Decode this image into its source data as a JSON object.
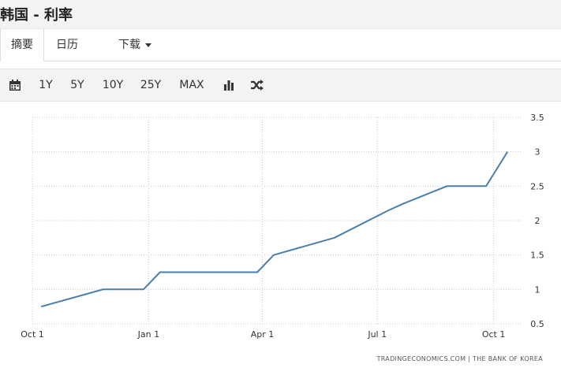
{
  "header": {
    "title": "韩国 - 利率"
  },
  "tabs": [
    {
      "label": "摘要",
      "active": true
    },
    {
      "label": "日历",
      "active": false
    },
    {
      "label": "下载",
      "active": false
    }
  ],
  "toolbar": {
    "calendar_icon": "calendar-icon",
    "ranges": [
      "1Y",
      "5Y",
      "10Y",
      "25Y",
      "MAX"
    ],
    "bar_chart_icon": "bar-chart-icon",
    "shuffle_icon": "shuffle-icon"
  },
  "colors": {
    "line": "#4a7fad",
    "grid": "#cccccc",
    "toolbar_bg": "#f3f3f3"
  },
  "chart_data": {
    "type": "line",
    "series": [
      {
        "values": [
          [
            "2020-10-08",
            0.75
          ],
          [
            "2020-11-26",
            1.0
          ],
          [
            "2020-12-28",
            1.0
          ],
          [
            "2021-01-10",
            1.25
          ],
          [
            "2021-03-28",
            1.25
          ],
          [
            "2021-04-10",
            1.5
          ],
          [
            "2021-05-28",
            1.75
          ],
          [
            "2021-07-10",
            2.15
          ],
          [
            "2021-07-22",
            2.25
          ],
          [
            "2021-08-25",
            2.5
          ],
          [
            "2021-09-25",
            2.5
          ],
          [
            "2021-10-12",
            3.0
          ]
        ]
      }
    ],
    "x_ticks": [
      {
        "date": "2020-10-01",
        "label": "Oct 1"
      },
      {
        "date": "2021-01-01",
        "label": "Jan 1"
      },
      {
        "date": "2021-04-01",
        "label": "Apr 1"
      },
      {
        "date": "2021-07-01",
        "label": "Jul 1"
      },
      {
        "date": "2021-10-01",
        "label": "Oct 1"
      }
    ],
    "y_ticks": [
      "0.5",
      "1",
      "1.5",
      "2",
      "2.5",
      "3",
      "3.5"
    ],
    "ylim": [
      0.5,
      3.5
    ],
    "xlim": [
      "2020-10-01",
      "2021-10-20"
    ],
    "grid": true,
    "y_axis_side": "right",
    "source": "TRADINGECONOMICS.COM | THE BANK OF KOREA"
  }
}
